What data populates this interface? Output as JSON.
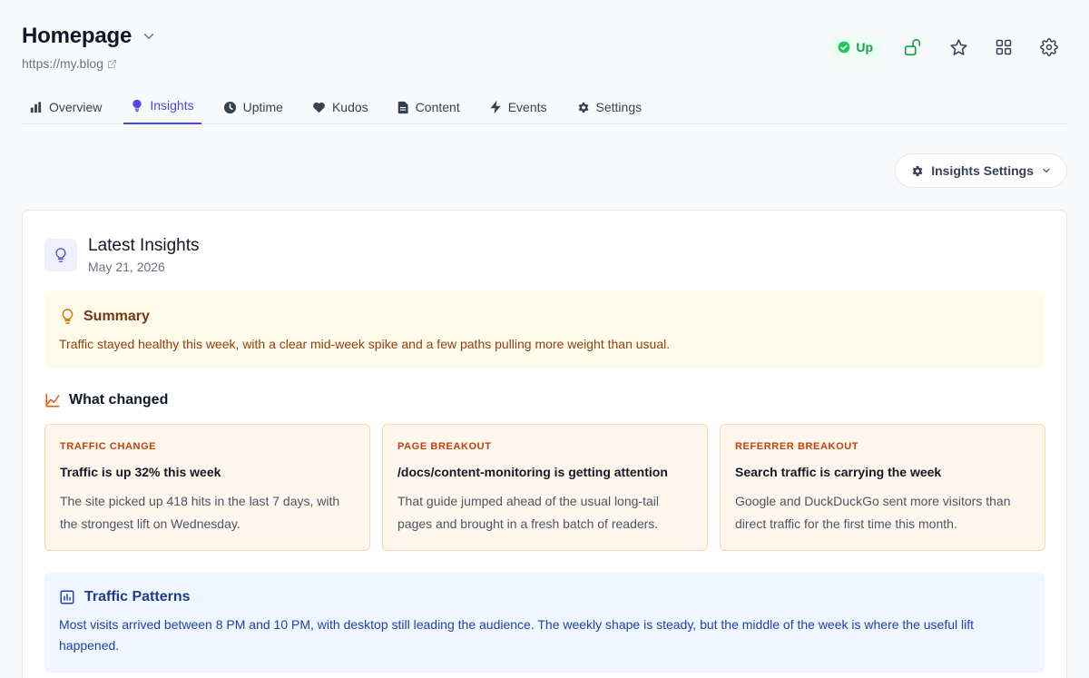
{
  "header": {
    "title": "Homepage",
    "url": "https://my.blog"
  },
  "status": {
    "label": "Up",
    "color": "#16a34a"
  },
  "top_icons": [
    "lock-open-icon",
    "star-icon",
    "grid-icon",
    "gear-icon"
  ],
  "tabs": [
    {
      "label": "Overview",
      "icon": "bar-chart-icon"
    },
    {
      "label": "Insights",
      "icon": "lightbulb-icon",
      "active": true
    },
    {
      "label": "Uptime",
      "icon": "clock-icon"
    },
    {
      "label": "Kudos",
      "icon": "heart-icon"
    },
    {
      "label": "Content",
      "icon": "document-icon"
    },
    {
      "label": "Events",
      "icon": "bolt-icon"
    },
    {
      "label": "Settings",
      "icon": "gear-icon"
    }
  ],
  "insights_settings": {
    "label": "Insights Settings"
  },
  "card": {
    "title": "Latest Insights",
    "date": "May 21, 2026"
  },
  "summary": {
    "title": "Summary",
    "text": "Traffic stayed healthy this week, with a clear mid-week spike and a few paths pulling more weight than usual."
  },
  "what_changed": {
    "title": "What changed",
    "items": [
      {
        "label": "TRAFFIC CHANGE",
        "heading": "Traffic is up 32% this week",
        "body": "The site picked up 418 hits in the last 7 days, with the strongest lift on Wednesday."
      },
      {
        "label": "PAGE BREAKOUT",
        "heading": "/docs/content-monitoring is getting attention",
        "body": "That guide jumped ahead of the usual long-tail pages and brought in a fresh batch of readers."
      },
      {
        "label": "REFERRER BREAKOUT",
        "heading": "Search traffic is carrying the week",
        "body": "Google and DuckDuckGo sent more visitors than direct traffic for the first time this month."
      }
    ]
  },
  "patterns": {
    "title": "Traffic Patterns",
    "text": "Most visits arrived between 8 PM and 10 PM, with desktop still leading the audience. The weekly shape is steady, but the middle of the week is where the useful lift happened."
  },
  "colors": {
    "accent": "#4f46e5",
    "summary_bg": "#fffbeb",
    "change_bg": "#fff7ed",
    "patterns_bg": "#eff6ff"
  }
}
